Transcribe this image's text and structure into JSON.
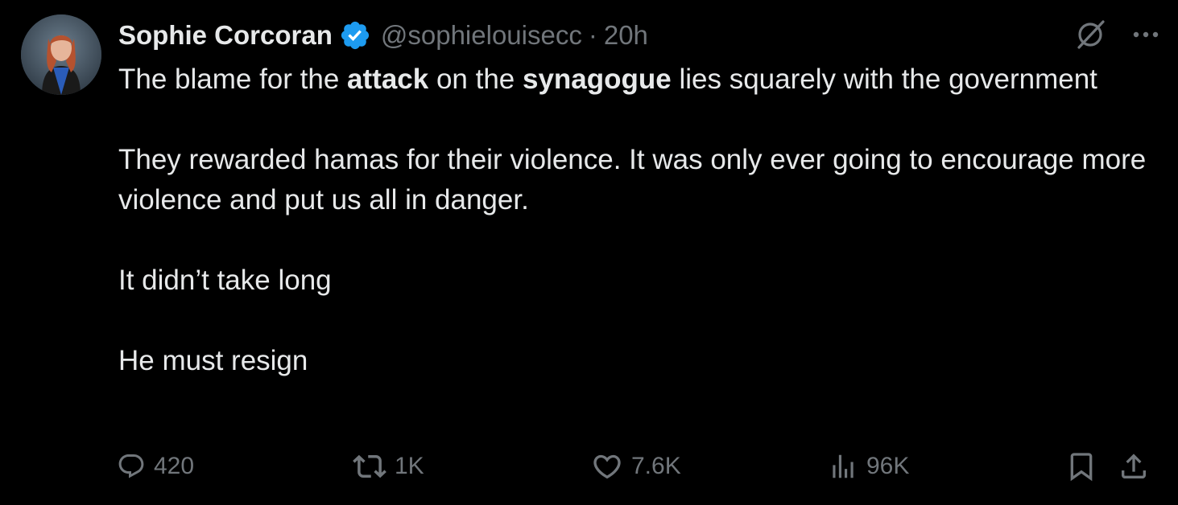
{
  "author": {
    "display_name": "Sophie Corcoran",
    "handle": "@sophielouisecc",
    "separator": "·",
    "time": "20h",
    "verified": true
  },
  "tweet": {
    "paragraphs": [
      [
        {
          "text": "The blame for the ",
          "bold": false
        },
        {
          "text": "attack",
          "bold": true
        },
        {
          "text": " on the ",
          "bold": false
        },
        {
          "text": "synagogue",
          "bold": true
        },
        {
          "text": " lies squarely with the government",
          "bold": false
        }
      ],
      [
        {
          "text": "They rewarded hamas for their violence. It was only ever going to encourage more violence and put us all in danger.",
          "bold": false
        }
      ],
      [
        {
          "text": "It didn’t take long",
          "bold": false
        }
      ],
      [
        {
          "text": "He must resign",
          "bold": false
        }
      ]
    ]
  },
  "actions": {
    "replies": "420",
    "reposts": "1K",
    "likes": "7.6K",
    "views": "96K"
  },
  "icons": {
    "verified": "verified-badge-icon",
    "grok": "grok-icon",
    "more": "more-icon",
    "reply": "reply-icon",
    "repost": "repost-icon",
    "like": "like-icon",
    "views": "views-icon",
    "bookmark": "bookmark-icon",
    "share": "share-icon"
  },
  "colors": {
    "background": "#000000",
    "text": "#e7e9ea",
    "secondary": "#71767b",
    "verified": "#1d9bf0"
  }
}
